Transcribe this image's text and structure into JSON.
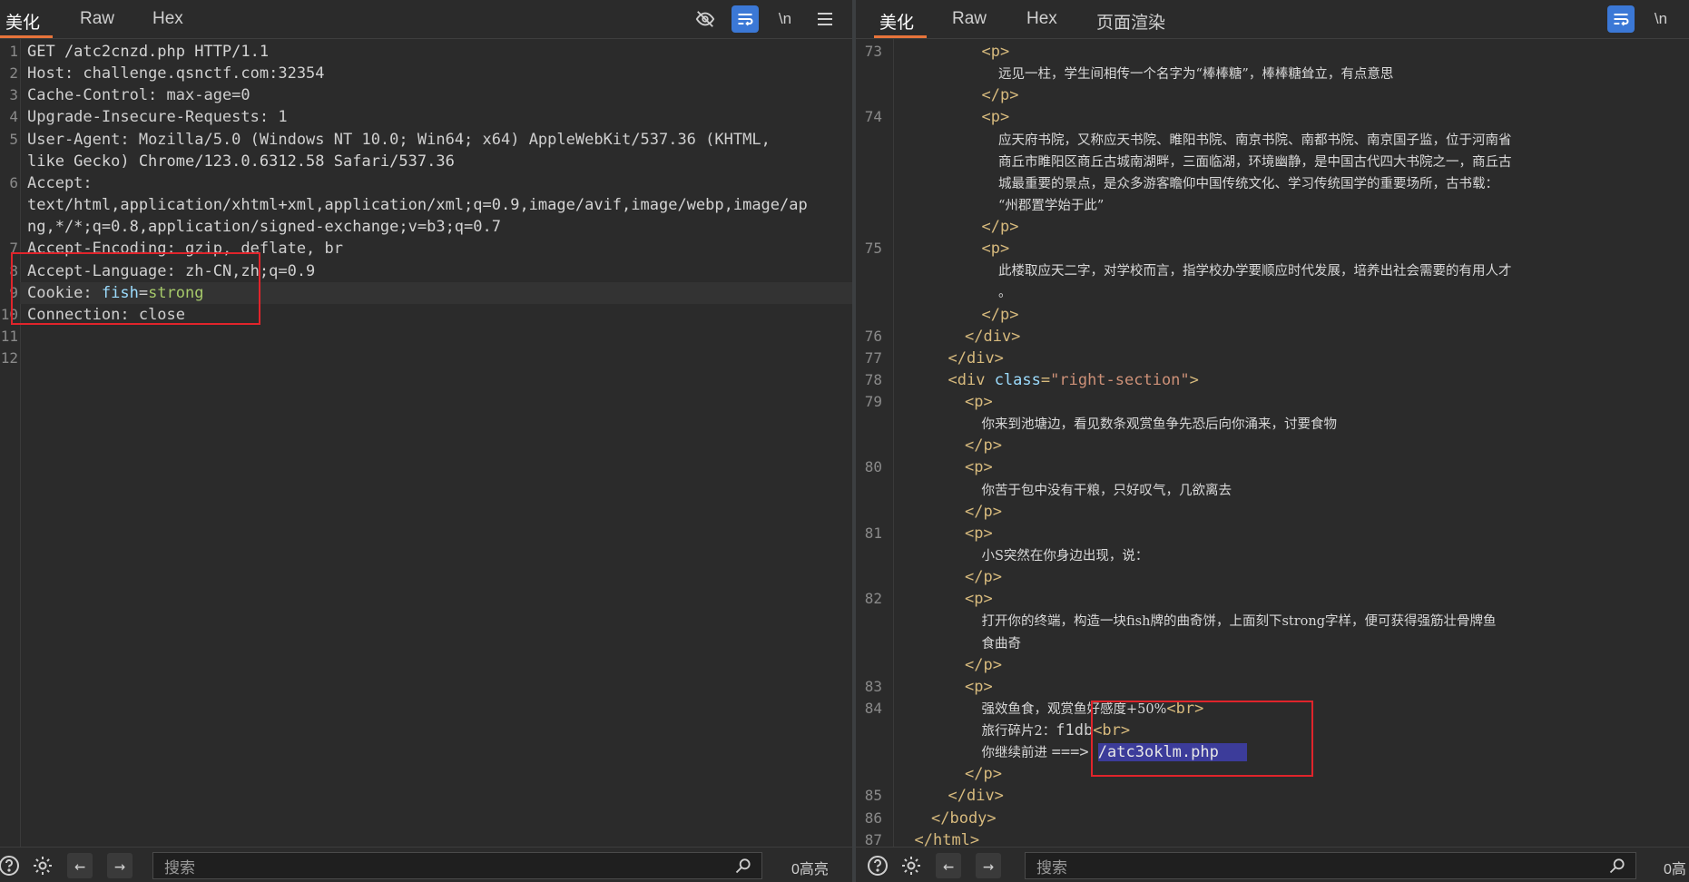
{
  "left": {
    "tabs": [
      "美化",
      "Raw",
      "Hex"
    ],
    "lines": [
      {
        "n": "1",
        "t": "GET /atc2cnzd.php HTTP/1.1"
      },
      {
        "n": "2",
        "k": "Host: ",
        "v": "challenge.qsnctf.com:32354"
      },
      {
        "n": "3",
        "k": "Cache-Control: ",
        "v": "max-age=0"
      },
      {
        "n": "4",
        "k": "Upgrade-Insecure-Requests: ",
        "v": "1"
      },
      {
        "n": "5",
        "k": "User-Agent: ",
        "v": "Mozilla/5.0 (Windows NT 10.0; Win64; x64) AppleWebKit/537.36 (KHTML,"
      },
      {
        "n": "",
        "t": "like Gecko) Chrome/123.0.6312.58 Safari/537.36"
      },
      {
        "n": "6",
        "k": "Accept:",
        "v": ""
      },
      {
        "n": "",
        "t": "text/html,application/xhtml+xml,application/xml;q=0.9,image/avif,image/webp,image/ap"
      },
      {
        "n": "",
        "t": "ng,*/*;q=0.8,application/signed-exchange;v=b3;q=0.7"
      },
      {
        "n": "7",
        "k": "Accept-Encoding: ",
        "v": "gzip, deflate, br"
      },
      {
        "n": "8",
        "k": "Accept-Language: ",
        "v": "zh-CN,zh;q=0.9"
      },
      {
        "n": "9",
        "k": "Cookie: ",
        "c1": "fish",
        "c2": "=",
        "c3": "strong"
      },
      {
        "n": "10",
        "k": "Connection: ",
        "v": "close"
      },
      {
        "n": "11",
        "t": ""
      },
      {
        "n": "12",
        "t": ""
      }
    ],
    "search_placeholder": "搜索",
    "hits": "0高亮"
  },
  "right": {
    "tabs": [
      "美化",
      "Raw",
      "Hex",
      "页面渲染"
    ],
    "search_placeholder": "搜索",
    "hits": "0高",
    "lines": [
      {
        "n": "73",
        "i": 5,
        "parts": [
          [
            "tag",
            "<p>"
          ]
        ]
      },
      {
        "n": "",
        "i": 6,
        "parts": [
          [
            "cn",
            "远见一柱，学生间相传一个名字为“棒棒糖”，棒棒糖耸立，有点意思"
          ]
        ]
      },
      {
        "n": "",
        "i": 5,
        "parts": [
          [
            "tag",
            "</p>"
          ]
        ]
      },
      {
        "n": "74",
        "i": 5,
        "parts": [
          [
            "tag",
            "<p>"
          ]
        ]
      },
      {
        "n": "",
        "i": 6,
        "parts": [
          [
            "cn",
            "应天府书院，又称应天书院、睢阳书院、南京书院、南都书院、南京国子监，位于河南省"
          ]
        ]
      },
      {
        "n": "",
        "i": 6,
        "parts": [
          [
            "cn",
            "商丘市睢阳区商丘古城南湖畔，三面临湖，环境幽静，是中国古代四大书院之一，商丘古"
          ]
        ]
      },
      {
        "n": "",
        "i": 6,
        "parts": [
          [
            "cn",
            "城最重要的景点，是众多游客瞻仰中国传统文化、学习传统国学的重要场所，古书载："
          ]
        ]
      },
      {
        "n": "",
        "i": 6,
        "parts": [
          [
            "cn",
            "“州郡置学始于此”"
          ]
        ]
      },
      {
        "n": "",
        "i": 5,
        "parts": [
          [
            "tag",
            "</p>"
          ]
        ]
      },
      {
        "n": "75",
        "i": 5,
        "parts": [
          [
            "tag",
            "<p>"
          ]
        ]
      },
      {
        "n": "",
        "i": 6,
        "parts": [
          [
            "cn",
            "此楼取应天二字，对学校而言，指学校办学要顺应时代发展，培养出社会需要的有用人才"
          ]
        ]
      },
      {
        "n": "",
        "i": 6,
        "parts": [
          [
            "cn",
            "。"
          ]
        ]
      },
      {
        "n": "",
        "i": 5,
        "parts": [
          [
            "tag",
            "</p>"
          ]
        ]
      },
      {
        "n": "76",
        "i": 4,
        "parts": [
          [
            "tag",
            "</div>"
          ]
        ]
      },
      {
        "n": "77",
        "i": 3,
        "parts": [
          [
            "tag",
            "</div>"
          ]
        ]
      },
      {
        "n": "78",
        "i": 3,
        "parts": [
          [
            "tag",
            "<div "
          ],
          [
            "attr",
            "class"
          ],
          [
            "tag",
            "="
          ],
          [
            "str",
            "\"right-section\""
          ],
          [
            "tag",
            ">"
          ]
        ]
      },
      {
        "n": "79",
        "i": 4,
        "parts": [
          [
            "tag",
            "<p>"
          ]
        ]
      },
      {
        "n": "",
        "i": 5,
        "parts": [
          [
            "cn",
            "你来到池塘边，看见数条观赏鱼争先恐后向你涌来，讨要食物"
          ]
        ]
      },
      {
        "n": "",
        "i": 4,
        "parts": [
          [
            "tag",
            "</p>"
          ]
        ]
      },
      {
        "n": "80",
        "i": 4,
        "parts": [
          [
            "tag",
            "<p>"
          ]
        ]
      },
      {
        "n": "",
        "i": 5,
        "parts": [
          [
            "cn",
            "你苦于包中没有干粮，只好叹气，几欲离去"
          ]
        ]
      },
      {
        "n": "",
        "i": 4,
        "parts": [
          [
            "tag",
            "</p>"
          ]
        ]
      },
      {
        "n": "81",
        "i": 4,
        "parts": [
          [
            "tag",
            "<p>"
          ]
        ]
      },
      {
        "n": "",
        "i": 5,
        "parts": [
          [
            "cn",
            "小S突然在你身边出现，说："
          ]
        ]
      },
      {
        "n": "",
        "i": 4,
        "parts": [
          [
            "tag",
            "</p>"
          ]
        ]
      },
      {
        "n": "82",
        "i": 4,
        "parts": [
          [
            "tag",
            "<p>"
          ]
        ]
      },
      {
        "n": "",
        "i": 5,
        "parts": [
          [
            "cn",
            "打开你的终端，构造一块fish牌的曲奇饼，上面刻下strong字样，便可获得强筋壮骨牌鱼"
          ]
        ]
      },
      {
        "n": "",
        "i": 5,
        "parts": [
          [
            "cn",
            "食曲奇"
          ]
        ]
      },
      {
        "n": "",
        "i": 4,
        "parts": [
          [
            "tag",
            "</p>"
          ]
        ]
      },
      {
        "n": "83",
        "i": 4,
        "parts": [
          [
            "tag",
            "<p>"
          ]
        ]
      },
      {
        "n": "84",
        "i": 5,
        "parts": [
          [
            "cn",
            "强效鱼食，观赏鱼好感度+50%"
          ],
          [
            "tag",
            "<br>"
          ]
        ]
      },
      {
        "n": "",
        "i": 5,
        "parts": [
          [
            "cn",
            "旅行碎片2："
          ],
          [
            "k",
            "f1db"
          ],
          [
            "tag",
            "<br>"
          ]
        ]
      },
      {
        "n": "",
        "i": 5,
        "parts": [
          [
            "cn",
            "你继续前进 "
          ],
          [
            "k",
            "===> "
          ],
          [
            "sel",
            "/atc3oklm.php   "
          ]
        ]
      },
      {
        "n": "",
        "i": 4,
        "parts": [
          [
            "tag",
            "</p>"
          ]
        ]
      },
      {
        "n": "85",
        "i": 3,
        "parts": [
          [
            "tag",
            "</div>"
          ]
        ]
      },
      {
        "n": "86",
        "i": 2,
        "parts": [
          [
            "tag",
            "</body>"
          ]
        ]
      },
      {
        "n": "87",
        "i": 1,
        "parts": [
          [
            "tag",
            "</html>"
          ]
        ]
      }
    ]
  },
  "icons": {
    "hide": "eye-slash-icon",
    "wrap": "word-wrap-icon",
    "newline": "\\n",
    "menu": "hamburger-menu-icon",
    "help": "?",
    "settings": "gear-icon",
    "back": "←",
    "forward": "→",
    "search": "search-icon"
  },
  "colors": {
    "accent": "#e8743b",
    "blue_button": "#3b78d6",
    "highlight_box": "#e0242b",
    "selection": "#3c3c9a"
  }
}
